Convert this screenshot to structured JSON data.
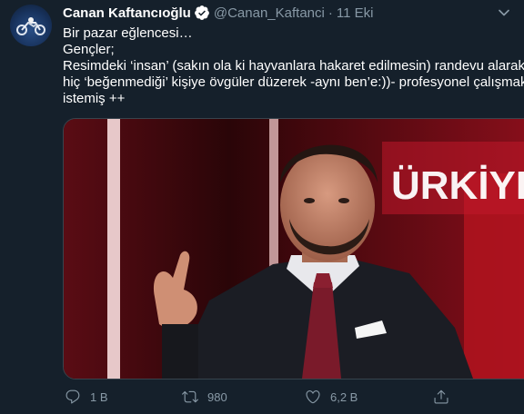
{
  "tweet": {
    "author_name": "Canan Kaftancıoğlu",
    "handle": "@Canan_Kaftanci",
    "separator": "·",
    "date": "11 Eki",
    "text_lines": [
      "Bir pazar eğlencesi…",
      "Gençler;",
      "Resimdeki ‘insan’ (sakın ola ki hayvanlara hakaret edilmesin) randevu alarak",
      "hiç ‘beğenmediği’ kişiye övgüler düzerek -aynı ben’e:))- profesyonel çalışmak",
      "istemiş ++"
    ],
    "media_overlay_text": "ÜRKİYE",
    "reply_count": "1 B",
    "retweet_count": "980",
    "like_count": "6,2 B"
  },
  "icons": {
    "verified": "verified-badge-icon",
    "caret": "chevron-down-icon",
    "reply": "reply-icon",
    "retweet": "retweet-icon",
    "like": "heart-icon",
    "share": "share-icon"
  },
  "colors": {
    "background": "#15202b",
    "secondary_text": "#8899a6",
    "verified_blue": "#1da1f2",
    "media_red": "#a8121f"
  }
}
